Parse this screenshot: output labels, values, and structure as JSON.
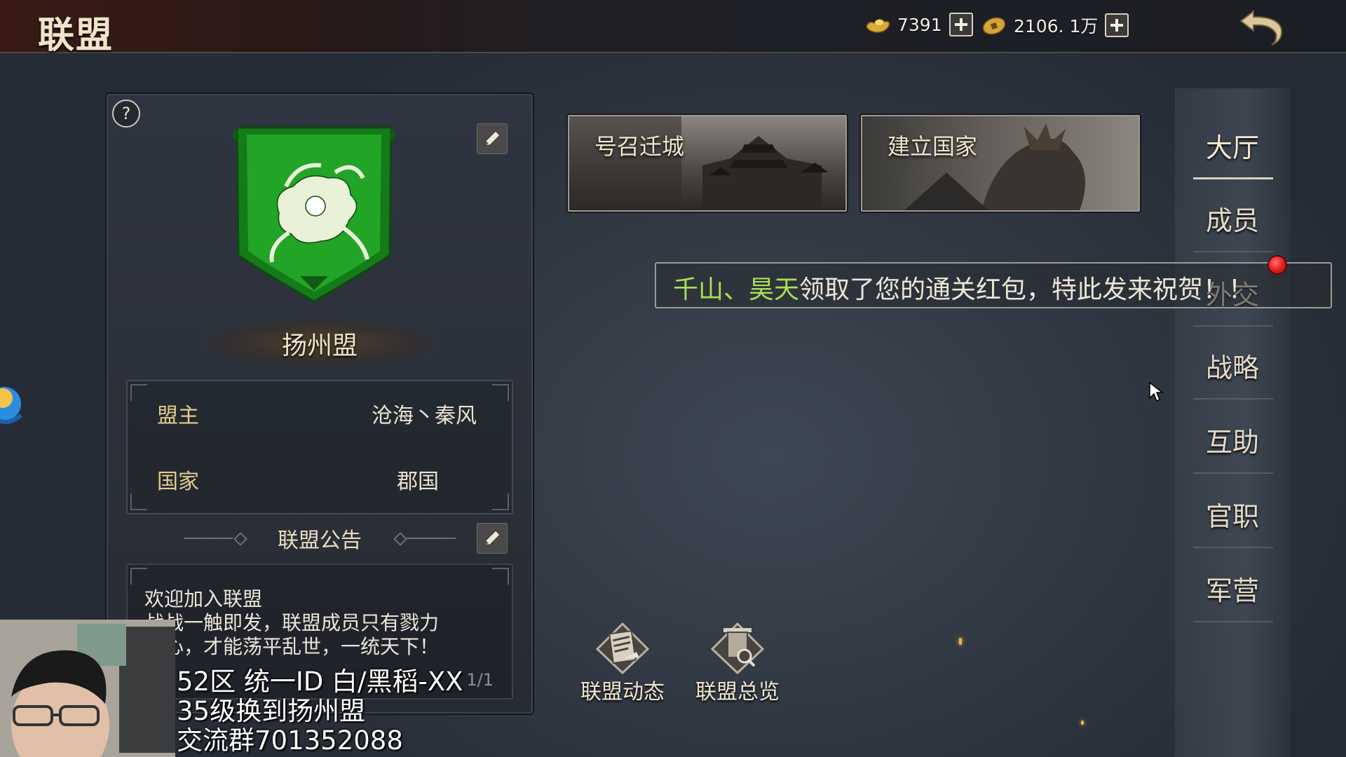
{
  "header": {
    "title": "联盟",
    "ingot_amount": "7391",
    "coin_amount": "2106. 1万"
  },
  "alliance": {
    "name": "扬州盟",
    "help_symbol": "?",
    "info": [
      {
        "key": "盟主",
        "value": "沧海丶秦风"
      },
      {
        "key": "国家",
        "value": "郡国"
      }
    ],
    "notice_title": "联盟公告",
    "notice_text": "欢迎加入联盟\n战战一触即发，联盟成员只有戮力\n同心，才能荡平乱世，一统天下！",
    "notice_page": "1/1",
    "emblem_color": "#1f9a22"
  },
  "tiles": [
    {
      "label": "号召迁城"
    },
    {
      "label": "建立国家"
    }
  ],
  "banner": {
    "name1": "千山",
    "sep": "、",
    "name2": "昊天",
    "message": "领取了您的通关红包，特此发来祝贺！！"
  },
  "nav": {
    "items": [
      {
        "label": "大厅",
        "active": true
      },
      {
        "label": "成员",
        "active": false
      },
      {
        "label": "外交",
        "active": false
      },
      {
        "label": "战略",
        "active": false
      },
      {
        "label": "互助",
        "active": false
      },
      {
        "label": "官职",
        "active": false
      },
      {
        "label": "军营",
        "active": false
      }
    ]
  },
  "actions": [
    {
      "label": "联盟动态"
    },
    {
      "label": "联盟总览"
    }
  ],
  "stream_overlay": {
    "text": "52区 统一ID 白/黑稻-XX\n35级换到扬州盟\n交流群701352088"
  }
}
